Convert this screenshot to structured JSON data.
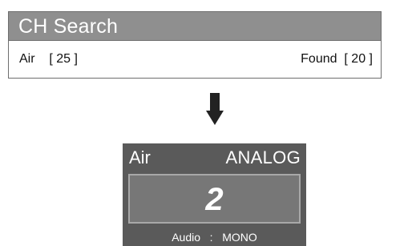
{
  "search": {
    "title": "CH Search",
    "source_label": "Air    [ 25 ]",
    "found_label": "Found  [ 20 ]"
  },
  "channel": {
    "source": "Air",
    "mode": "ANALOG",
    "number": "2",
    "audio_line": "Audio   :   MONO"
  },
  "icons": {
    "transition": "arrow-down-icon"
  },
  "colors": {
    "header_bg": "#8f8f8f",
    "channel_box_bg": "#5a5a5a",
    "channel_number_bg": "#777777"
  }
}
